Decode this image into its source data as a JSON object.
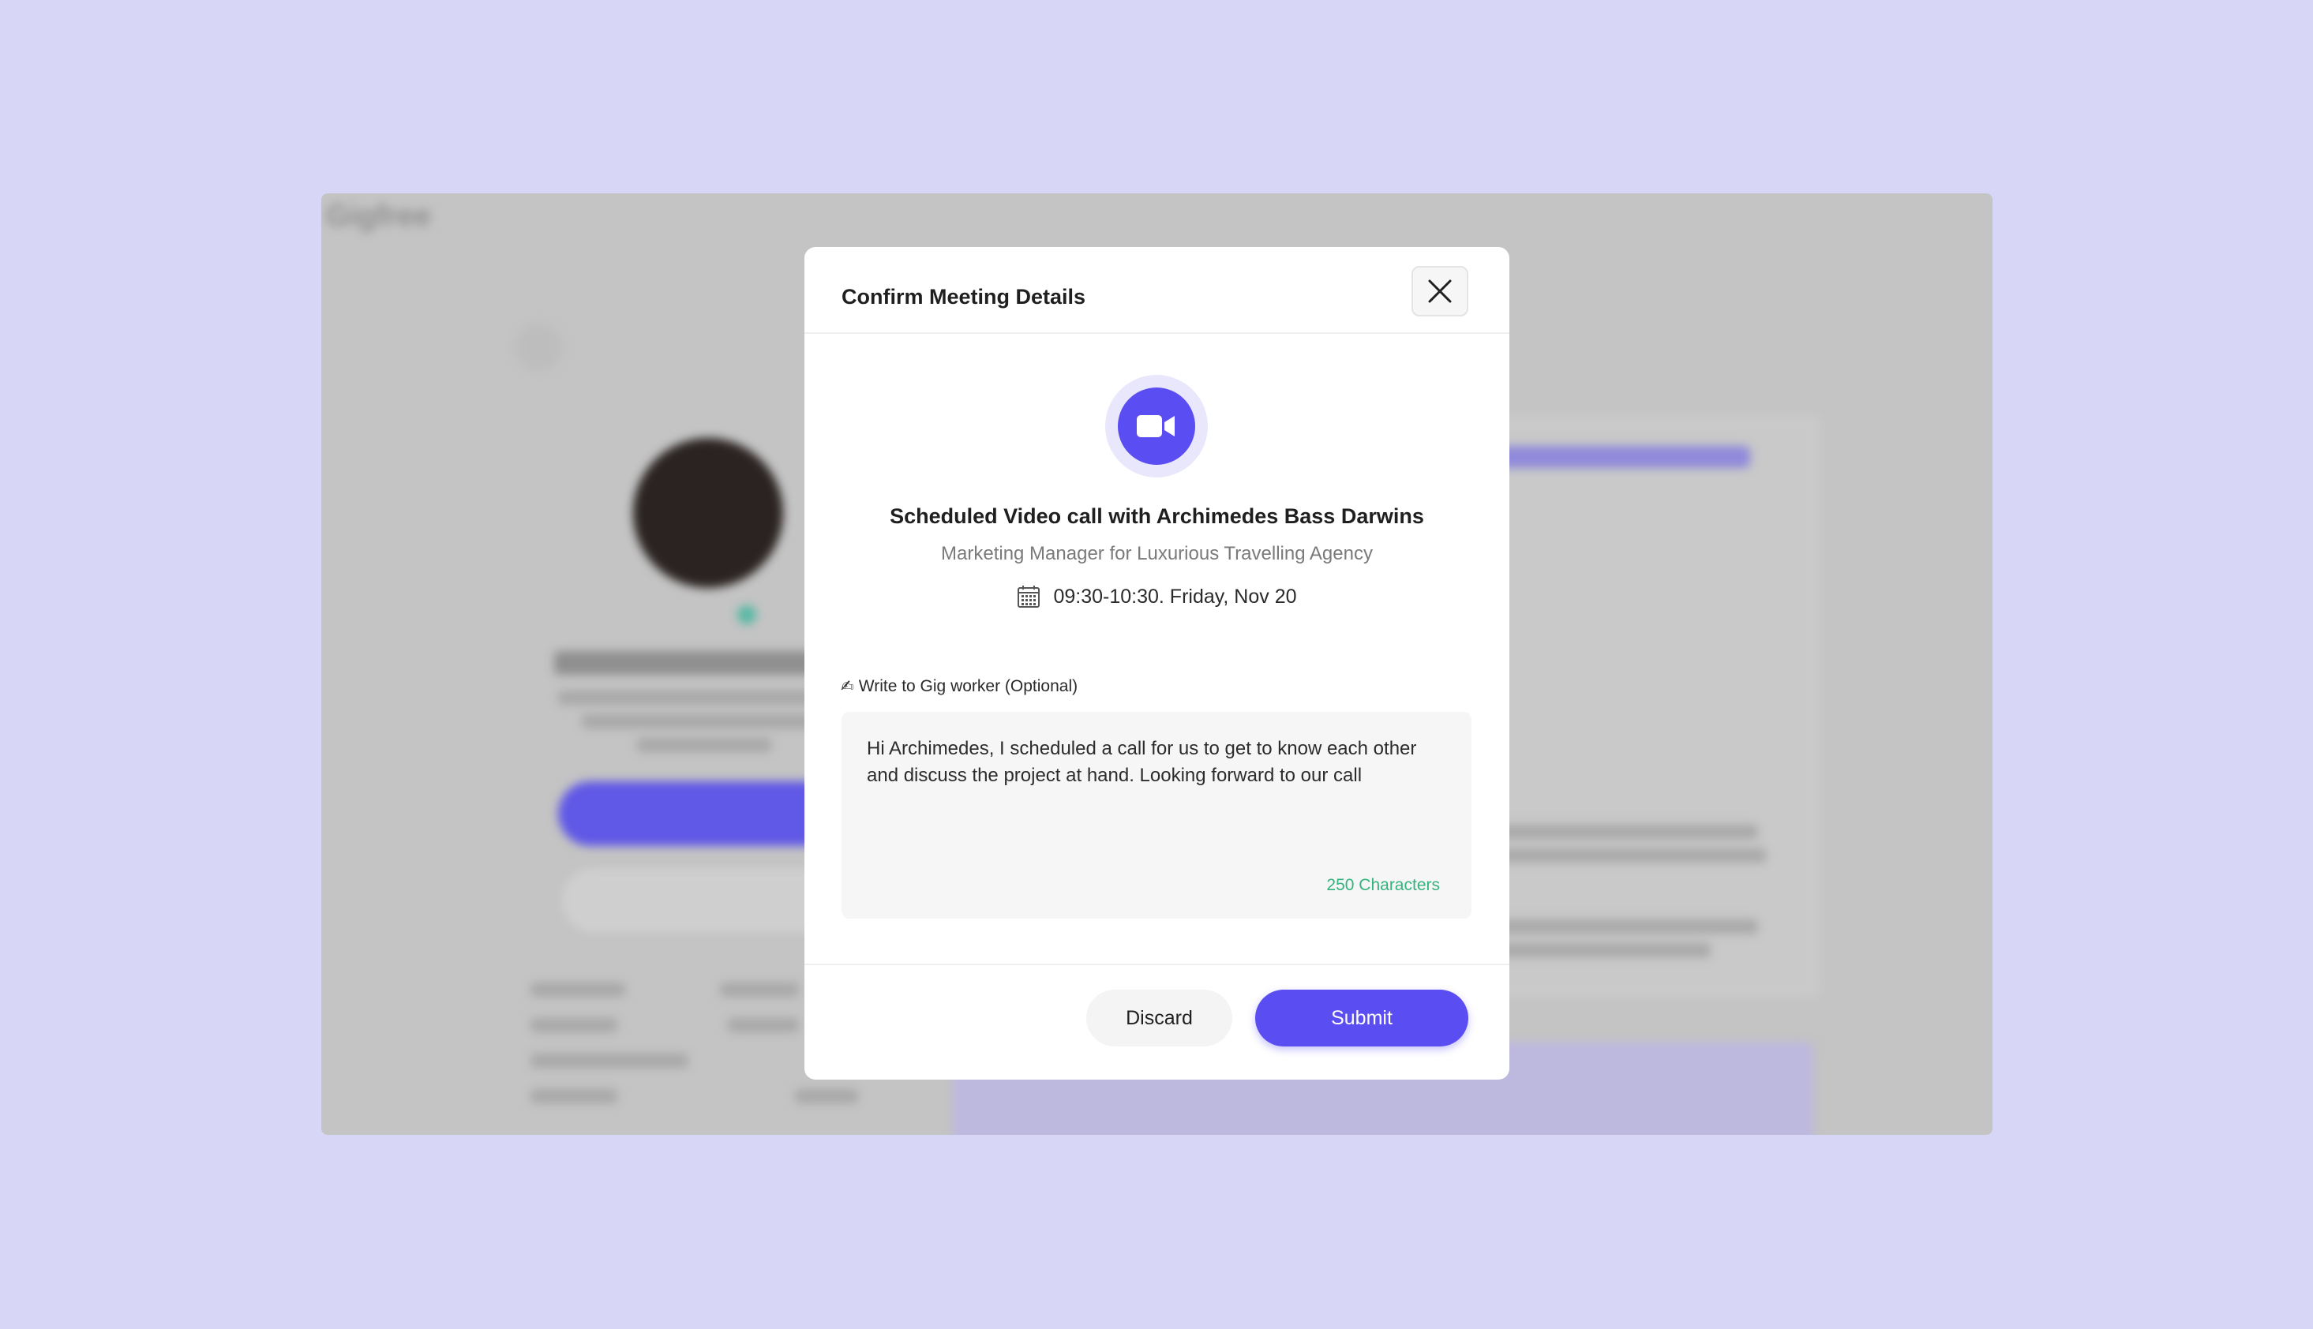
{
  "background": {
    "app_logo": "Gigfree"
  },
  "modal": {
    "title": "Confirm Meeting Details",
    "close_icon": "close-icon",
    "call_icon": "video-camera-icon",
    "call_title": "Scheduled Video call with Archimedes Bass Darwins",
    "call_subtitle": "Marketing Manager for Luxurious Travelling Agency",
    "calendar_icon": "calendar-icon",
    "call_time": "09:30-10:30. Friday, Nov 20",
    "write_label": "Write to Gig worker (Optional)",
    "write_icon": "writing-hand-icon",
    "message": "Hi Archimedes, I scheduled a call for us to get to know each other and discuss the project at hand. Looking forward to our call",
    "char_count": "250 Characters",
    "discard_label": "Discard",
    "submit_label": "Submit"
  },
  "colors": {
    "page_background": "#d8d6f6",
    "accent": "#5a4df2",
    "char_count": "#35b37e"
  }
}
